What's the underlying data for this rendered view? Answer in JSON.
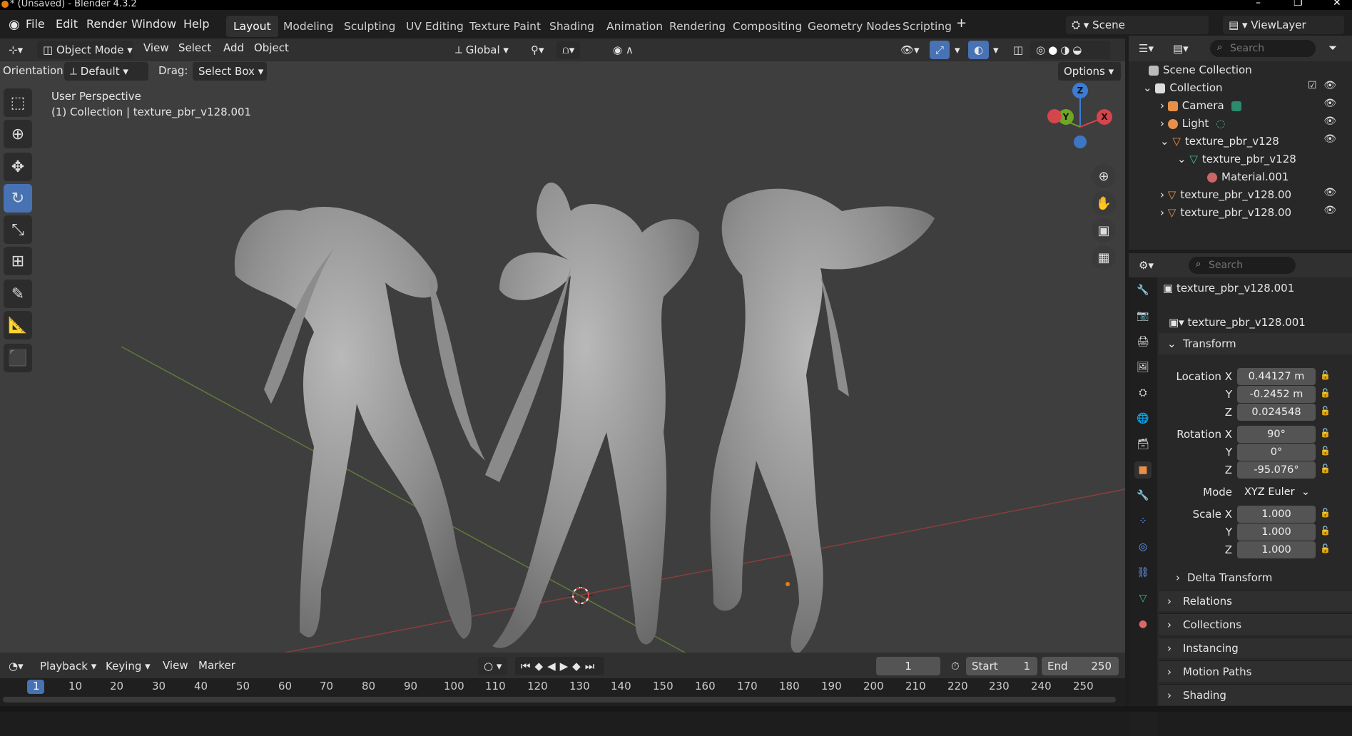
{
  "titlebar": {
    "title": "* (Unsaved) - Blender 4.3.2"
  },
  "menu": [
    "File",
    "Edit",
    "Render",
    "Window",
    "Help"
  ],
  "workspaces": [
    "Layout",
    "Modeling",
    "Sculpting",
    "UV Editing",
    "Texture Paint",
    "Shading",
    "Animation",
    "Rendering",
    "Compositing",
    "Geometry Nodes",
    "Scripting"
  ],
  "active_workspace": "Layout",
  "scene": "Scene",
  "view_layer": "ViewLayer",
  "viewport_header": {
    "mode": "Object Mode",
    "view": "View",
    "select": "Select",
    "add": "Add",
    "object": "Object",
    "transform": "Global"
  },
  "tool_settings": {
    "orientation_label": "Orientation:",
    "orientation": "Default",
    "drag_label": "Drag:",
    "drag": "Select Box",
    "options": "Options"
  },
  "overlay_text": {
    "line1": "User Perspective",
    "line2": "(1) Collection | texture_pbr_v128.001"
  },
  "gizmo": {
    "z": "Z",
    "y": "Y",
    "x": "X"
  },
  "outliner": {
    "search_placeholder": "Search",
    "items": [
      "Scene Collection",
      "Collection",
      "Camera",
      "Light",
      "texture_pbr_v128",
      "texture_pbr_v128",
      "Material.001",
      "texture_pbr_v128.00",
      "texture_pbr_v128.00"
    ]
  },
  "properties": {
    "search_placeholder": "Search",
    "object_name": "texture_pbr_v128.001",
    "object_field": "texture_pbr_v128.001",
    "transform_header": "Transform",
    "location_x_label": "Location X",
    "location_x": "0.44127 m",
    "location_y": "-0.2452 m",
    "location_z": "0.024548",
    "rotation_x_label": "Rotation X",
    "rotation_x": "90°",
    "rotation_y": "0°",
    "rotation_z": "-95.076°",
    "mode_label": "Mode",
    "mode": "XYZ Euler",
    "scale_x_label": "Scale X",
    "scale_x": "1.000",
    "scale_y": "1.000",
    "scale_z": "1.000",
    "y_label": "Y",
    "z_label": "Z",
    "sections": [
      "Delta Transform",
      "Relations",
      "Collections",
      "Instancing",
      "Motion Paths",
      "Shading"
    ]
  },
  "timeline": {
    "playback": "Playback",
    "keying": "Keying",
    "view": "View",
    "marker": "Marker",
    "current_frame": "1",
    "start_label": "Start",
    "start": "1",
    "end_label": "End",
    "end": "250",
    "frames": [
      "1",
      "10",
      "20",
      "30",
      "40",
      "50",
      "60",
      "70",
      "80",
      "90",
      "100",
      "110",
      "120",
      "130",
      "140",
      "150",
      "160",
      "170",
      "180",
      "190",
      "200",
      "210",
      "220",
      "230",
      "240",
      "250"
    ]
  },
  "colors": {
    "accent": "#4772b3",
    "x_axis": "#d5454c",
    "y_axis": "#6fa626",
    "z_axis": "#3d7cd3",
    "object": "#e87d0d"
  }
}
